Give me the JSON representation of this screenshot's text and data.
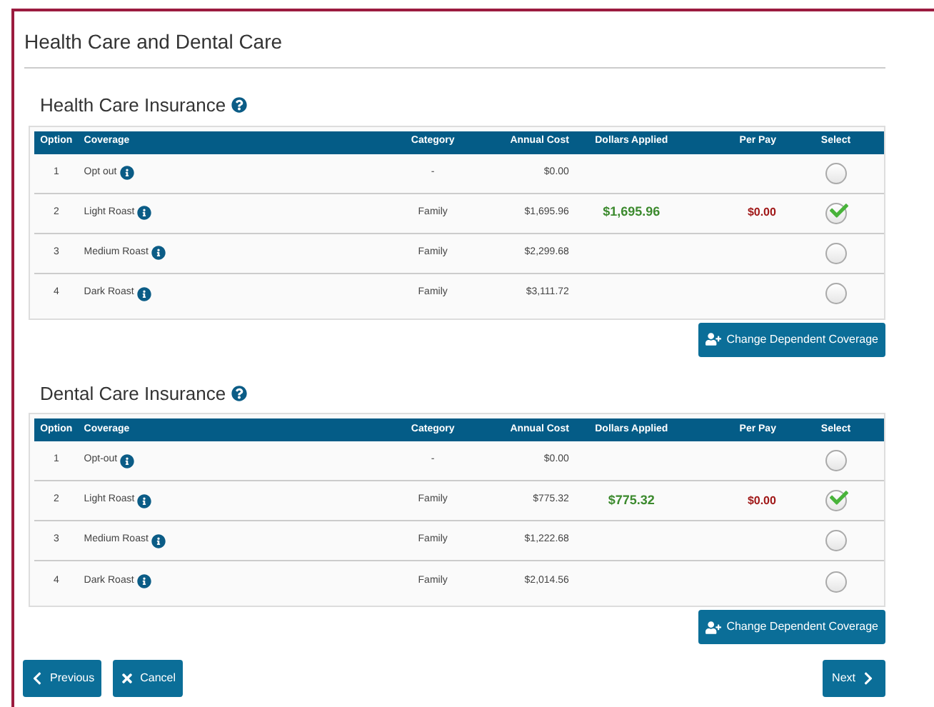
{
  "page_title": "Health Care and Dental Care",
  "sections": [
    {
      "title": "Health Care Insurance",
      "columns": [
        "Option",
        "Coverage",
        "Category",
        "Annual Cost",
        "Dollars Applied",
        "Per Pay",
        "Select"
      ],
      "rows": [
        {
          "option": "1",
          "coverage": "Opt out",
          "category": "-",
          "annual_cost": "$0.00",
          "selected": false
        },
        {
          "option": "2",
          "coverage": "Light Roast",
          "category": "Family",
          "annual_cost": "$1,695.96",
          "dollars_applied": "$1,695.96",
          "per_pay": "$0.00",
          "selected": true
        },
        {
          "option": "3",
          "coverage": "Medium Roast",
          "category": "Family",
          "annual_cost": "$2,299.68",
          "selected": false
        },
        {
          "option": "4",
          "coverage": "Dark Roast",
          "category": "Family",
          "annual_cost": "$3,111.72",
          "selected": false
        }
      ],
      "button": "Change Dependent Coverage"
    },
    {
      "title": "Dental Care Insurance",
      "columns": [
        "Option",
        "Coverage",
        "Category",
        "Annual Cost",
        "Dollars Applied",
        "Per Pay",
        "Select"
      ],
      "rows": [
        {
          "option": "1",
          "coverage": "Opt-out",
          "category": "-",
          "annual_cost": "$0.00",
          "selected": false
        },
        {
          "option": "2",
          "coverage": "Light Roast",
          "category": "Family",
          "annual_cost": "$775.32",
          "dollars_applied": "$775.32",
          "per_pay": "$0.00",
          "selected": true
        },
        {
          "option": "3",
          "coverage": "Medium Roast",
          "category": "Family",
          "annual_cost": "$1,222.68",
          "selected": false
        },
        {
          "option": "4",
          "coverage": "Dark Roast",
          "category": "Family",
          "annual_cost": "$2,014.56",
          "selected": false
        }
      ],
      "button": "Change Dependent Coverage"
    }
  ],
  "nav": {
    "previous": "Previous",
    "cancel": "Cancel",
    "next": "Next"
  }
}
